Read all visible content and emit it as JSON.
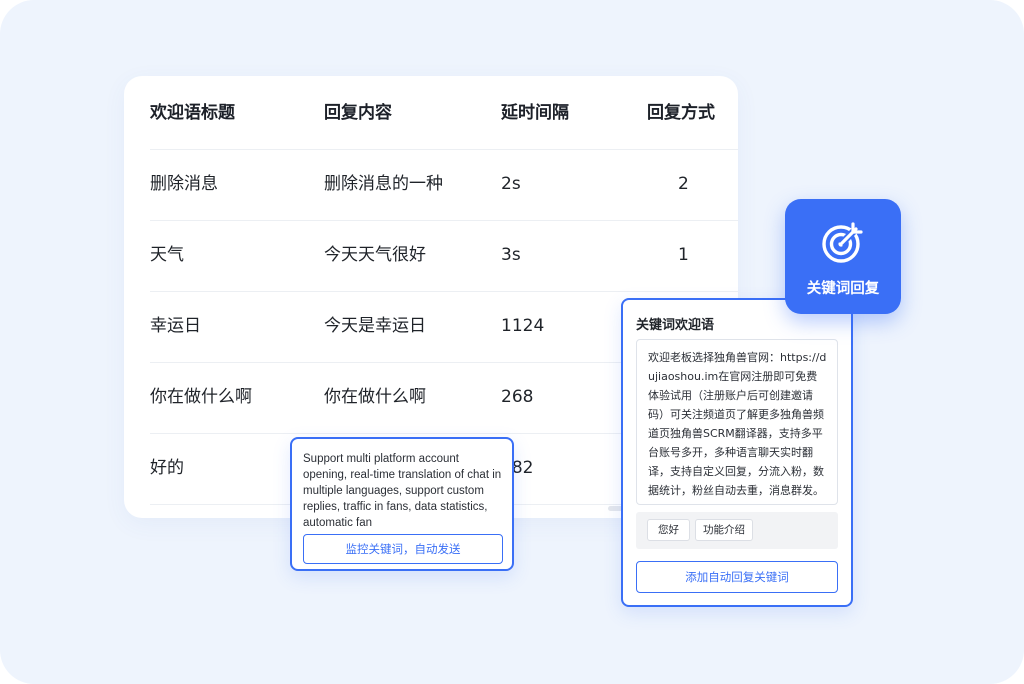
{
  "table": {
    "headers": [
      "欢迎语标题",
      "回复内容",
      "延时间隔",
      "回复方式"
    ],
    "rows": [
      [
        "删除消息",
        "删除消息的一种",
        "2s",
        "2"
      ],
      [
        "天气",
        "今天天气很好",
        "3s",
        "1"
      ],
      [
        "幸运日",
        "今天是幸运日",
        "1124",
        ""
      ],
      [
        "你在做什么啊",
        "你在做什么啊",
        "268",
        ""
      ],
      [
        "好的",
        "",
        "182",
        ""
      ]
    ]
  },
  "tooltip": {
    "text": "Support multi platform account opening, real-time translation of chat in multiple languages, support custom replies, traffic in fans, data statistics, automatic fan",
    "button_label": "监控关键词，自动发送"
  },
  "welcome_card": {
    "title": "关键词欢迎语",
    "body": "欢迎老板选择独角兽官网：https://dujiaoshou.im在官网注册即可免费体验试用（注册账户后可创建邀请码）可关注频道页了解更多独角兽频道页独角兽SCRM翻译器，支持多平台账号多开，多种语言聊天实时翻译，支持自定义回复，分流入粉，数据统计，粉丝自动去重，消息群发。",
    "chips": [
      "您好",
      "功能介绍"
    ],
    "add_button_label": "添加自动回复关键词"
  },
  "badge": {
    "label": "关键词回复",
    "icon": "target-icon"
  },
  "colors": {
    "background": "#eef4fd",
    "accent": "#3a6ff6",
    "card": "#ffffff",
    "text": "#1f2329"
  }
}
